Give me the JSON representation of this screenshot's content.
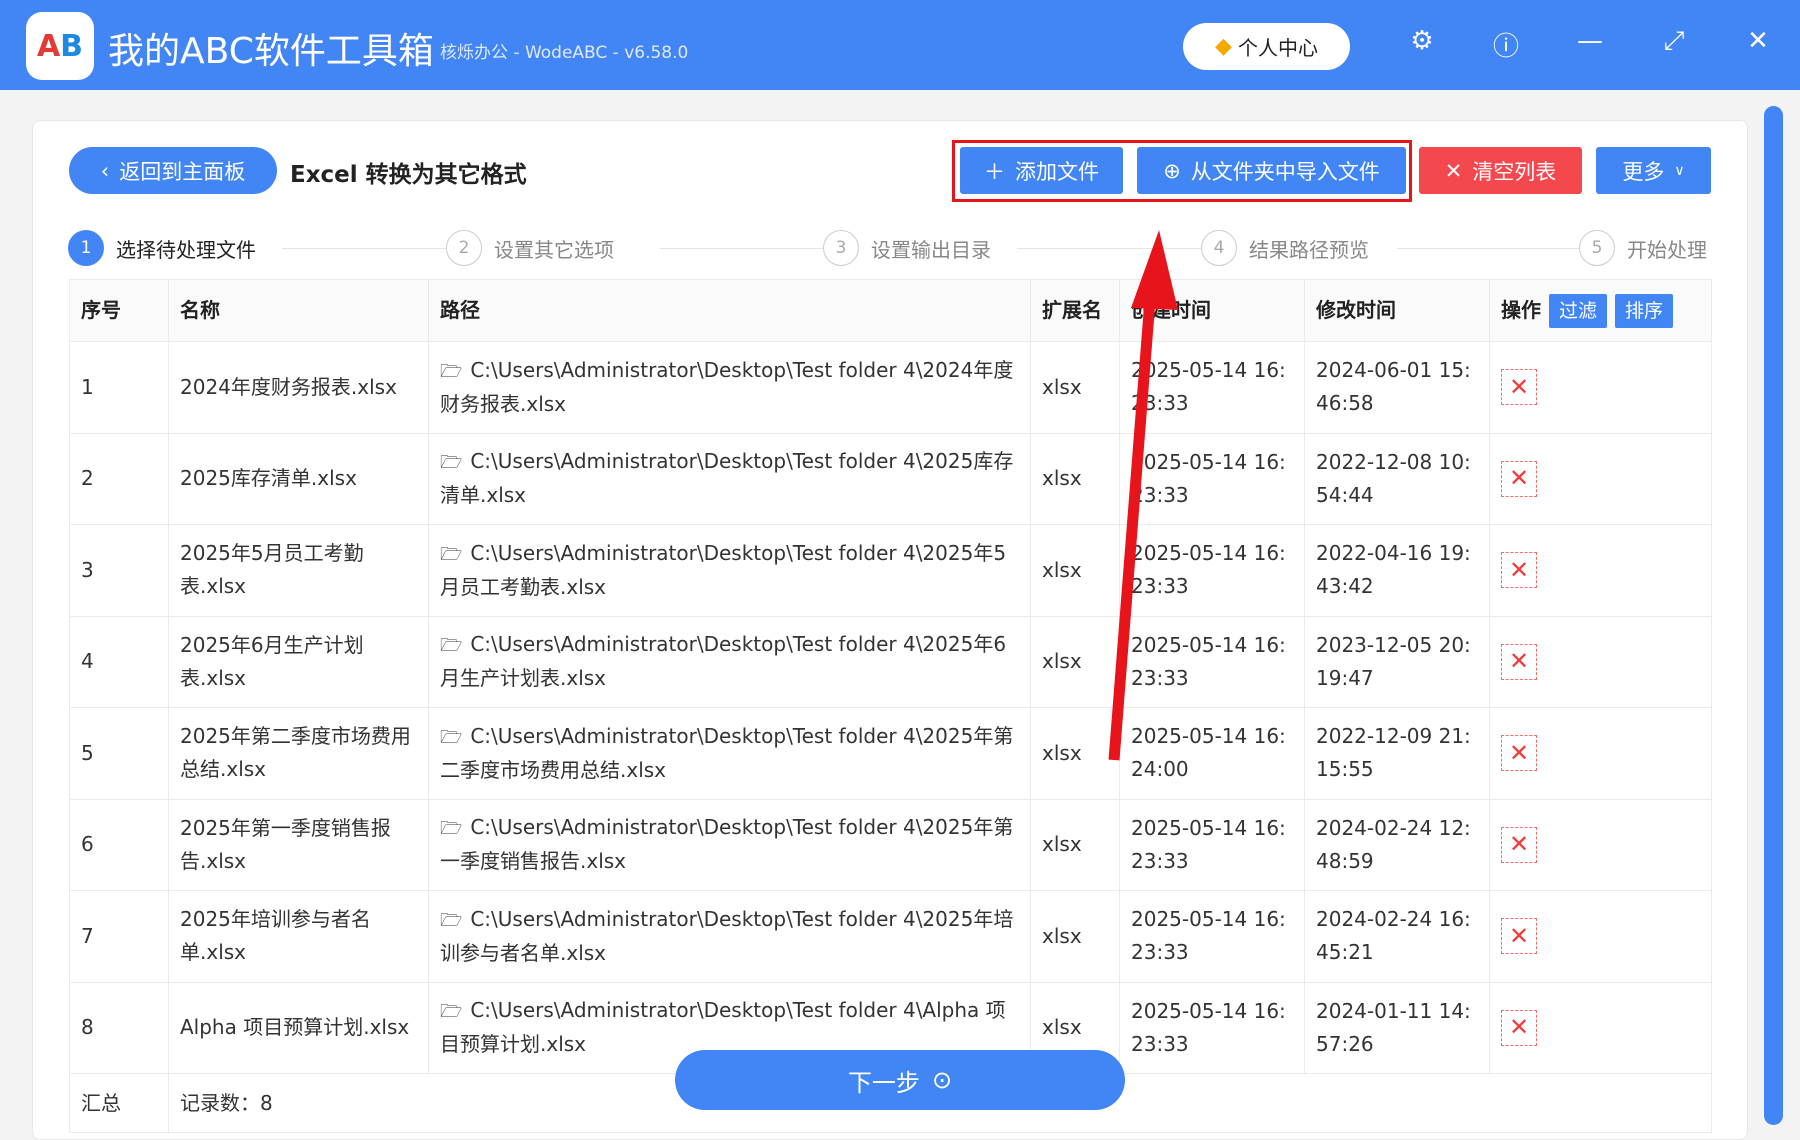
{
  "app": {
    "logo": "AB",
    "title": "我的ABC软件工具箱",
    "subtitle": "核烁办公 - WodeABC - v6.58.0",
    "user_center": "个人中心"
  },
  "toolbar": {
    "back": "返回到主面板",
    "page_title": "Excel 转换为其它格式",
    "add_file": "添加文件",
    "import_folder": "从文件夹中导入文件",
    "clear_list": "清空列表",
    "more": "更多"
  },
  "steps": [
    {
      "num": "1",
      "label": "选择待处理文件"
    },
    {
      "num": "2",
      "label": "设置其它选项"
    },
    {
      "num": "3",
      "label": "设置输出目录"
    },
    {
      "num": "4",
      "label": "结果路径预览"
    },
    {
      "num": "5",
      "label": "开始处理"
    }
  ],
  "table": {
    "headers": {
      "index": "序号",
      "name": "名称",
      "path": "路径",
      "ext": "扩展名",
      "created": "创建时间",
      "modified": "修改时间",
      "action": "操作",
      "filter": "过滤",
      "sort": "排序"
    },
    "rows": [
      {
        "index": "1",
        "name": "2024年度财务报表.xlsx",
        "path": "C:\\Users\\Administrator\\Desktop\\Test folder 4\\2024年度财务报表.xlsx",
        "ext": "xlsx",
        "created": "2025-05-14 16:23:33",
        "modified": "2024-06-01 15:46:58"
      },
      {
        "index": "2",
        "name": "2025库存清单.xlsx",
        "path": "C:\\Users\\Administrator\\Desktop\\Test folder 4\\2025库存清单.xlsx",
        "ext": "xlsx",
        "created": "2025-05-14 16:23:33",
        "modified": "2022-12-08 10:54:44"
      },
      {
        "index": "3",
        "name": "2025年5月员工考勤表.xlsx",
        "path": "C:\\Users\\Administrator\\Desktop\\Test folder 4\\2025年5月员工考勤表.xlsx",
        "ext": "xlsx",
        "created": "2025-05-14 16:23:33",
        "modified": "2022-04-16 19:43:42"
      },
      {
        "index": "4",
        "name": "2025年6月生产计划表.xlsx",
        "path": "C:\\Users\\Administrator\\Desktop\\Test folder 4\\2025年6月生产计划表.xlsx",
        "ext": "xlsx",
        "created": "2025-05-14 16:23:33",
        "modified": "2023-12-05 20:19:47"
      },
      {
        "index": "5",
        "name": "2025年第二季度市场费用总结.xlsx",
        "path": "C:\\Users\\Administrator\\Desktop\\Test folder 4\\2025年第二季度市场费用总结.xlsx",
        "ext": "xlsx",
        "created": "2025-05-14 16:24:00",
        "modified": "2022-12-09 21:15:55"
      },
      {
        "index": "6",
        "name": "2025年第一季度销售报告.xlsx",
        "path": "C:\\Users\\Administrator\\Desktop\\Test folder 4\\2025年第一季度销售报告.xlsx",
        "ext": "xlsx",
        "created": "2025-05-14 16:23:33",
        "modified": "2024-02-24 12:48:59"
      },
      {
        "index": "7",
        "name": "2025年培训参与者名单.xlsx",
        "path": "C:\\Users\\Administrator\\Desktop\\Test folder 4\\2025年培训参与者名单.xlsx",
        "ext": "xlsx",
        "created": "2025-05-14 16:23:33",
        "modified": "2024-02-24 16:45:21"
      },
      {
        "index": "8",
        "name": "Alpha 项目预算计划.xlsx",
        "path": "C:\\Users\\Administrator\\Desktop\\Test folder 4\\Alpha 项目预算计划.xlsx",
        "ext": "xlsx",
        "created": "2025-05-14 16:23:33",
        "modified": "2024-01-11 14:57:26"
      }
    ],
    "summary_label": "汇总",
    "summary_value": "记录数：8"
  },
  "next_button": "下一步",
  "colors": {
    "primary": "#4285f4",
    "danger": "#f5474e",
    "highlight": "#e8141c"
  }
}
